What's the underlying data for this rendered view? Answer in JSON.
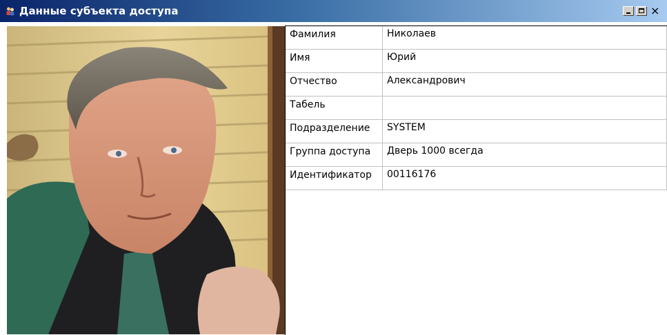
{
  "window": {
    "title": "Данные субъекта доступа",
    "controls": {
      "minimize_icon": "minimize-icon",
      "maximize_icon": "maximize-icon",
      "close_icon": "close-icon"
    }
  },
  "photo": {
    "icon": "person-photo"
  },
  "fields": [
    {
      "label": "Фамилия",
      "value": "Николаев"
    },
    {
      "label": "Имя",
      "value": "Юрий"
    },
    {
      "label": "Отчество",
      "value": "Александрович"
    },
    {
      "label": "Табель",
      "value": ""
    },
    {
      "label": "Подразделение",
      "value": "SYSTEM"
    },
    {
      "label": "Группа доступа",
      "value": "Дверь 1000 всегда"
    },
    {
      "label": "Идентификатор",
      "value": "00116176"
    }
  ]
}
